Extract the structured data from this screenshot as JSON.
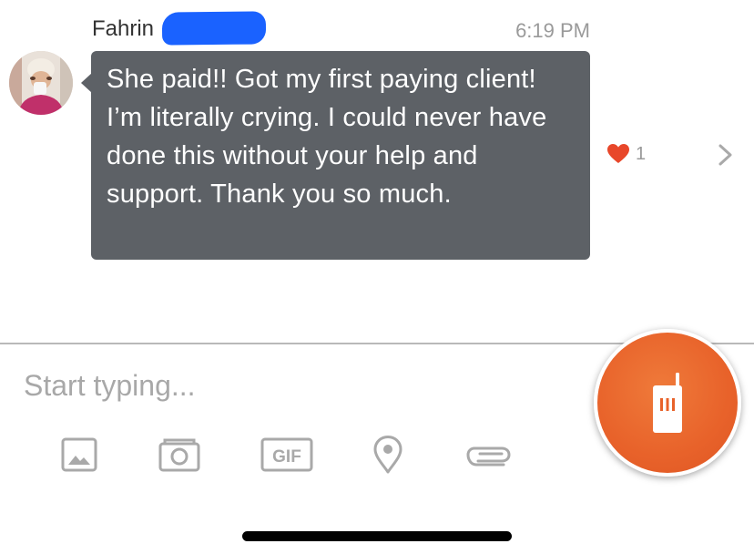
{
  "message": {
    "sender_name": "Fahrin",
    "timestamp": "6:19 PM",
    "text": "She paid!! Got my first paying client! I’m literally crying. I could never have done this without your help and support. Thank you so much.",
    "reaction": {
      "icon": "heart-icon",
      "count": "1",
      "color": "#e8472a"
    },
    "bubble_color": "#5d6166"
  },
  "composer": {
    "placeholder": "Start typing...",
    "tools": [
      {
        "name": "image-icon"
      },
      {
        "name": "camera-icon"
      },
      {
        "name": "gif-icon",
        "label": "GIF"
      },
      {
        "name": "location-pin-icon"
      },
      {
        "name": "paperclip-icon"
      }
    ]
  },
  "fab": {
    "icon": "walkie-talkie-icon",
    "color": "#e8622a"
  },
  "colors": {
    "redaction": "#1a62ff",
    "icon_gray": "#a9a9a9"
  }
}
